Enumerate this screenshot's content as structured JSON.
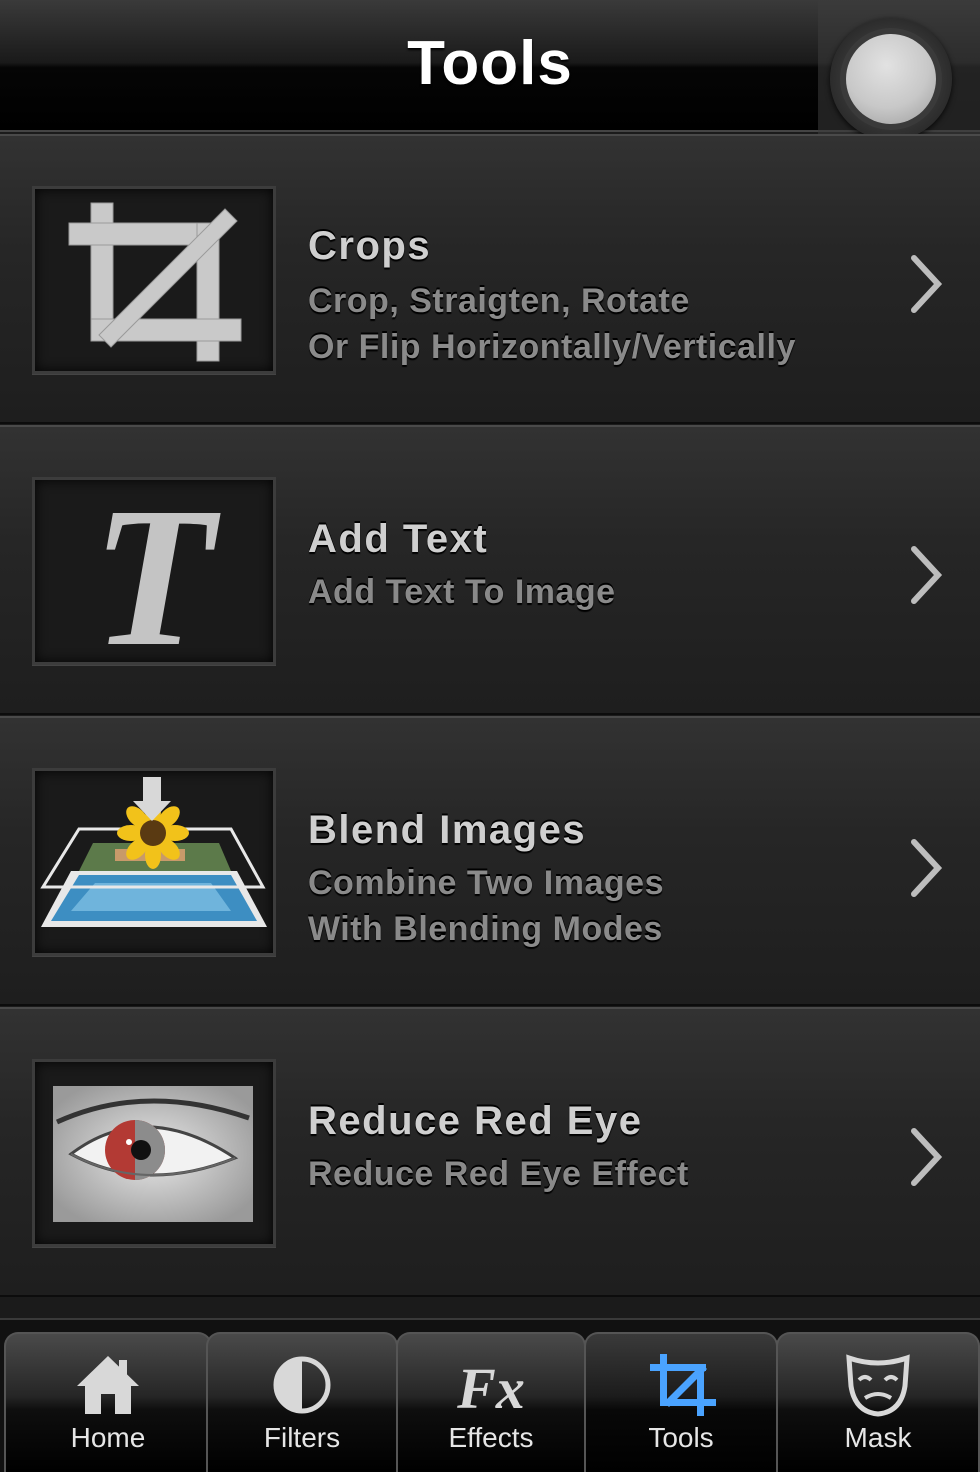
{
  "header": {
    "title": "Tools",
    "corner_button_icon": "round-record-button"
  },
  "rows": [
    {
      "title": "Crops",
      "subtitle_lines": [
        "Crop, Straigten, Rotate",
        "Or Flip Horizontally/Vertically"
      ],
      "icon": "crop-icon"
    },
    {
      "title": "Add Text",
      "subtitle_lines": [
        "Add Text To Image"
      ],
      "icon": "text-t-icon"
    },
    {
      "title": "Blend Images",
      "subtitle_lines": [
        "Combine Two Images",
        "With Blending Modes"
      ],
      "icon": "blend-layers-icon"
    },
    {
      "title": "Reduce Red Eye",
      "subtitle_lines": [
        "Reduce Red Eye Effect"
      ],
      "icon": "red-eye-icon"
    }
  ],
  "tabbar": {
    "active": "Tools",
    "tabs": [
      {
        "label": "Home",
        "icon": "home-icon"
      },
      {
        "label": "Filters",
        "icon": "half-circle-icon"
      },
      {
        "label": "Effects",
        "icon": "fx-icon"
      },
      {
        "label": "Tools",
        "icon": "crop-icon"
      },
      {
        "label": "Mask",
        "icon": "theater-mask-icon"
      }
    ]
  },
  "colors": {
    "active_tab_icon": "#4aa3ff",
    "inactive_tab_icon": "#d8d8d8",
    "row_title": "#cfcfcf",
    "row_subtitle": "#8a8a8a"
  }
}
